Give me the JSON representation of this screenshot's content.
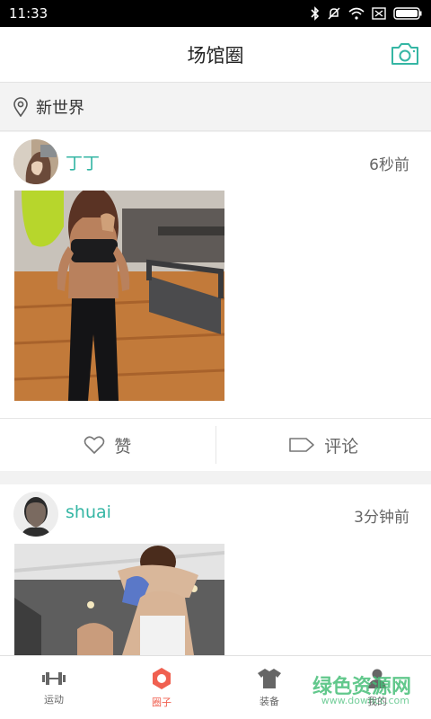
{
  "status_bar": {
    "time": "11:33",
    "icons": [
      "bluetooth-icon",
      "mute-icon",
      "wifi-icon",
      "no-sim-icon",
      "battery-icon"
    ]
  },
  "header": {
    "title": "场馆圈",
    "camera_icon": "camera-icon"
  },
  "location": {
    "icon": "location-pin-icon",
    "text": "新世界"
  },
  "posts": [
    {
      "username": "丁丁",
      "time": "6秒前",
      "like_label": "赞",
      "comment_label": "评论"
    },
    {
      "username": "shuai",
      "time": "3分钟前"
    }
  ],
  "tabs": [
    {
      "label": "运动",
      "icon": "dumbbell-icon"
    },
    {
      "label": "圈子",
      "icon": "circle-ring-icon"
    },
    {
      "label": "装备",
      "icon": "shirt-icon"
    },
    {
      "label": "我的",
      "icon": "person-icon"
    }
  ],
  "watermark": {
    "text": "绿色资源网",
    "sub": "www.downcc.com"
  },
  "colors": {
    "accent": "#35b6a4",
    "active_tab": "#f06050"
  }
}
